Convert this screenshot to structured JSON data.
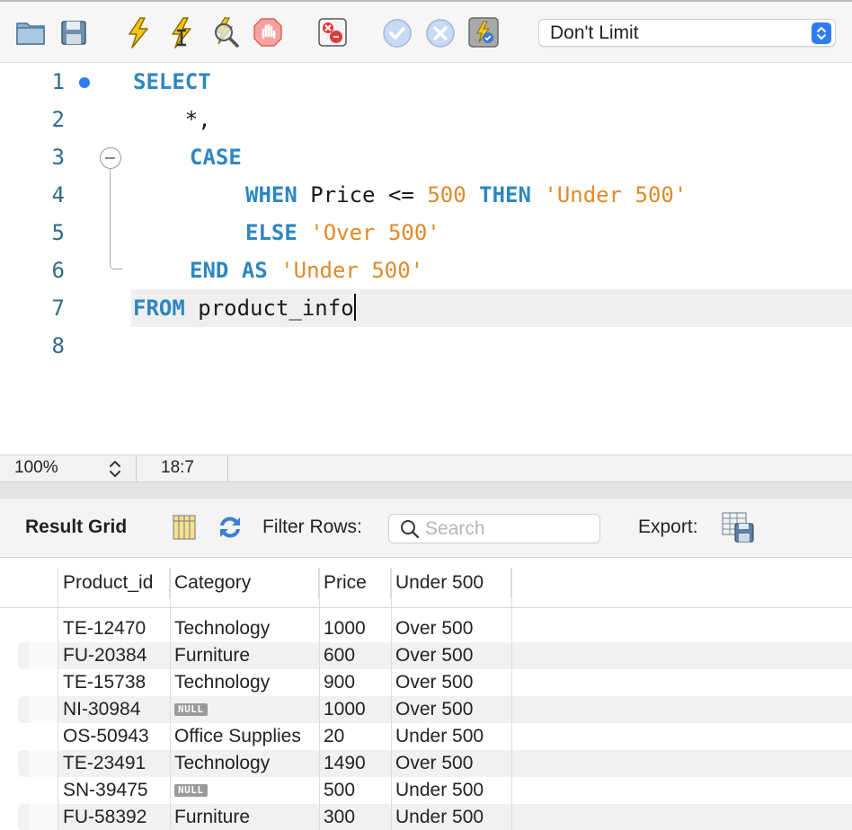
{
  "toolbar": {
    "icons": [
      "open-folder-icon",
      "save-icon",
      "execute-icon",
      "execute-current-icon",
      "explain-icon",
      "stop-icon",
      "toggle-error-icon",
      "commit-icon",
      "rollback-icon",
      "autocommit-icon"
    ],
    "limit_select": "Don't Limit"
  },
  "editor": {
    "line_numbers": [
      "1",
      "2",
      "3",
      "4",
      "5",
      "6",
      "7",
      "8"
    ],
    "lines": {
      "l1_kw": "SELECT",
      "l2_text": "    *,",
      "l3_kw": "CASE",
      "l4_kw_when": "WHEN",
      "l4_col": " Price ",
      "l4_op": "<=",
      "l4_num": "500",
      "l4_kw_then": "THEN",
      "l4_str": "'Under 500'",
      "l5_kw": "ELSE",
      "l5_str": "'Over 500'",
      "l6_kw_end": "END",
      "l6_kw_as": "AS",
      "l6_str": "'Under 500'",
      "l7_kw": "FROM",
      "l7_text": " product_info"
    }
  },
  "status": {
    "zoom": "100%",
    "cursor_pos": "18:7"
  },
  "results": {
    "title": "Result Grid",
    "filter_label": "Filter Rows:",
    "search_placeholder": "Search",
    "export_label": "Export:",
    "columns": [
      "Product_id",
      "Category",
      "Price",
      "Under 500"
    ],
    "rows": [
      {
        "id": "TE-12470",
        "category": "Technology",
        "price": "1000",
        "under": "Over 500"
      },
      {
        "id": "FU-20384",
        "category": "Furniture",
        "price": "600",
        "under": "Over 500"
      },
      {
        "id": "TE-15738",
        "category": "Technology",
        "price": "900",
        "under": "Over 500"
      },
      {
        "id": "NI-30984",
        "category": "NULL",
        "price": "1000",
        "under": "Over 500"
      },
      {
        "id": "OS-50943",
        "category": "Office Supplies",
        "price": "20",
        "under": "Under 500"
      },
      {
        "id": "TE-23491",
        "category": "Technology",
        "price": "1490",
        "under": "Over 500"
      },
      {
        "id": "SN-39475",
        "category": "NULL",
        "price": "500",
        "under": "Under 500"
      },
      {
        "id": "FU-58392",
        "category": "Furniture",
        "price": "300",
        "under": "Under 500"
      }
    ]
  }
}
